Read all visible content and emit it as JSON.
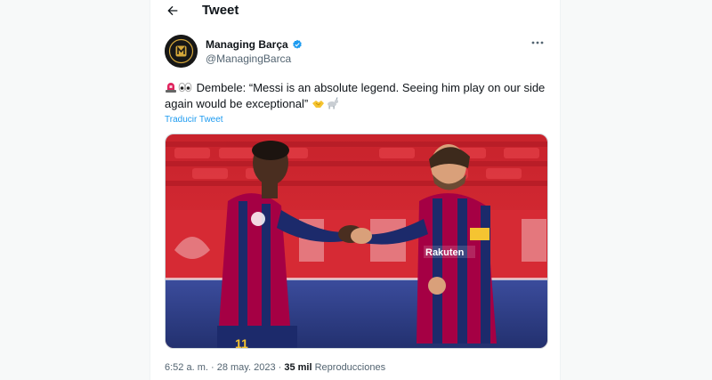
{
  "header": {
    "title": "Tweet"
  },
  "tweet": {
    "author_name": "Managing Barça",
    "author_handle": "@ManagingBarca",
    "avatar_text": "MANAGING BARÇA",
    "text": "Dembele: “Messi is an absolute legend. Seeing him play on our side again would be exceptional”",
    "emojis_leading": [
      "rotating-light-icon",
      "eyes-icon"
    ],
    "emojis_trailing": [
      "handshake-icon",
      "goat-icon"
    ],
    "translate_label": "Traducir Tweet",
    "image": {
      "description_icon": "photo-icon",
      "left_player_number": "11",
      "right_player_sponsor": "Rakuten"
    },
    "time": "6:52 a. m.",
    "date": "28 may. 2023",
    "views_count": "35 mil",
    "views_label": "Reproducciones",
    "separator": "·"
  },
  "colors": {
    "accent": "#1d9bf0",
    "text_primary": "#0f1419",
    "text_secondary": "#536471",
    "barca_red": "#a50044",
    "barca_blue": "#1c2a6b"
  }
}
